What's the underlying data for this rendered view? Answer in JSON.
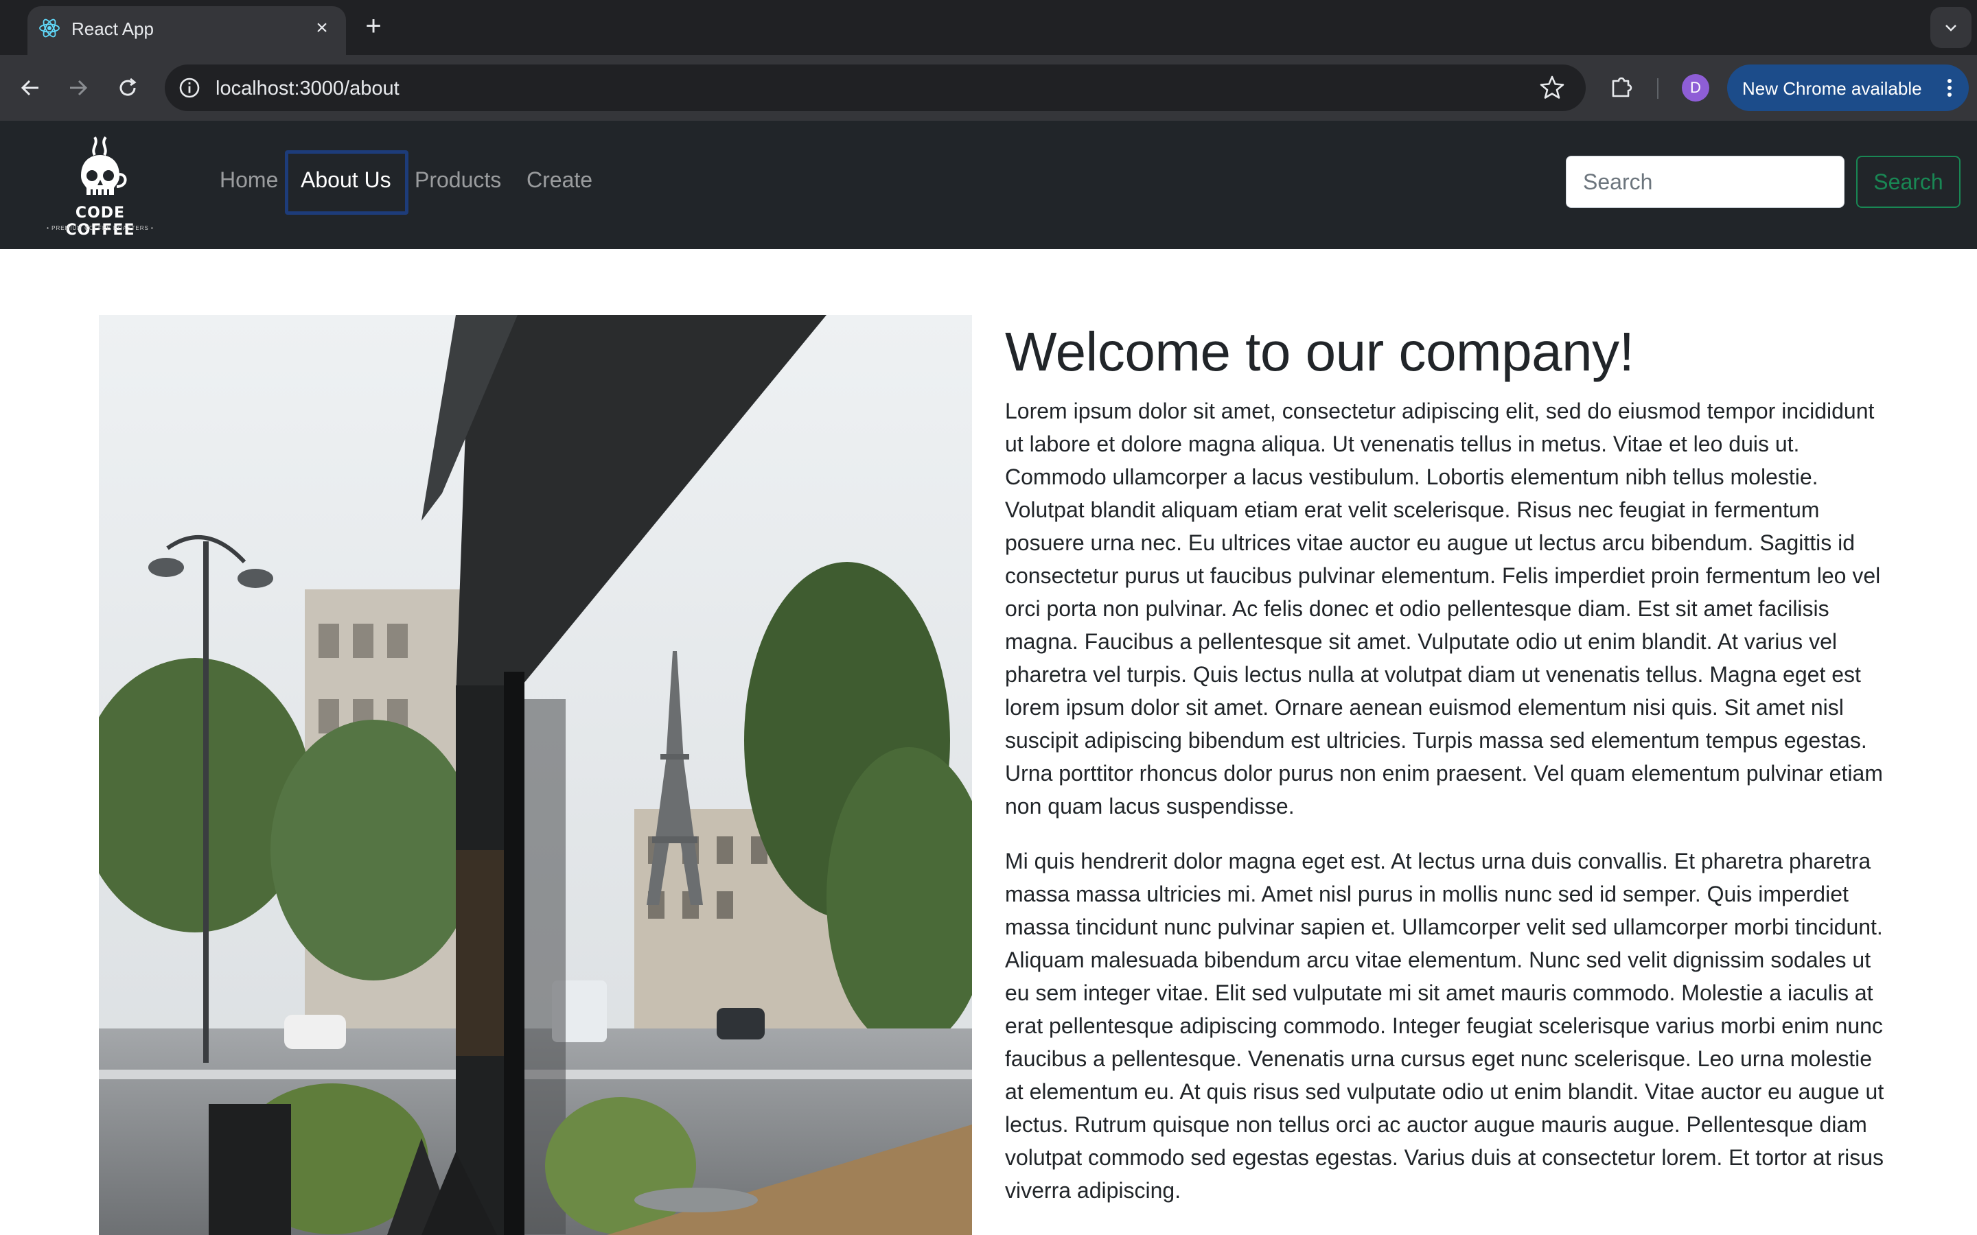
{
  "browser": {
    "tab_title": "React App",
    "tab_favicon": "react-atom-icon",
    "url": "localhost:3000/about",
    "profile_initial": "D",
    "update_label": "New Chrome available"
  },
  "navbar": {
    "brand_name": "CODE COFFEE",
    "brand_tagline": "• PREMIUM COFFEE ROASTERS •",
    "links": [
      "Home",
      "About Us",
      "Products",
      "Create"
    ],
    "active_link": "About Us",
    "search_placeholder": "Search",
    "search_button": "Search"
  },
  "main": {
    "image_alt": "Café window view onto a Paris street with the Eiffel Tower",
    "heading": "Welcome to our company!",
    "paragraphs": [
      "Lorem ipsum dolor sit amet, consectetur adipiscing elit, sed do eiusmod tempor incididunt ut labore et dolore magna aliqua. Ut venenatis tellus in metus. Vitae et leo duis ut. Commodo ullamcorper a lacus vestibulum. Lobortis elementum nibh tellus molestie. Volutpat blandit aliquam etiam erat velit scelerisque. Risus nec feugiat in fermentum posuere urna nec. Eu ultrices vitae auctor eu augue ut lectus arcu bibendum. Sagittis id consectetur purus ut faucibus pulvinar elementum. Felis imperdiet proin fermentum leo vel orci porta non pulvinar. Ac felis donec et odio pellentesque diam. Est sit amet facilisis magna. Faucibus a pellentesque sit amet. Vulputate odio ut enim blandit. At varius vel pharetra vel turpis. Quis lectus nulla at volutpat diam ut venenatis tellus. Magna eget est lorem ipsum dolor sit amet. Ornare aenean euismod elementum nisi quis. Sit amet nisl suscipit adipiscing bibendum est ultricies. Turpis massa sed elementum tempus egestas. Urna porttitor rhoncus dolor purus non enim praesent. Vel quam elementum pulvinar etiam non quam lacus suspendisse.",
      "Mi quis hendrerit dolor magna eget est. At lectus urna duis convallis. Et pharetra pharetra massa massa ultricies mi. Amet nisl purus in mollis nunc sed id semper. Quis imperdiet massa tincidunt nunc pulvinar sapien et. Ullamcorper velit sed ullamcorper morbi tincidunt. Aliquam malesuada bibendum arcu vitae elementum. Nunc sed velit dignissim sodales ut eu sem integer vitae. Elit sed vulputate mi sit amet mauris commodo. Molestie a iaculis at erat pellentesque adipiscing commodo. Integer feugiat scelerisque varius morbi enim nunc faucibus a pellentesque. Venenatis urna cursus eget nunc scelerisque. Leo urna molestie at elementum eu. At quis risus sed vulputate odio ut enim blandit. Vitae auctor eu augue ut lectus. Rutrum quisque non tellus orci ac auctor augue mauris augue. Pellentesque diam volutpat commodo sed egestas egestas. Varius duis at consectetur lorem. Et tortor at risus viverra adipiscing."
    ]
  },
  "colors": {
    "navbar_bg": "#212529",
    "search_button_accent": "#198754",
    "focus_ring": "#1d3c7a",
    "chrome_dark": "#202124",
    "chrome_toolbar": "#35363a"
  }
}
